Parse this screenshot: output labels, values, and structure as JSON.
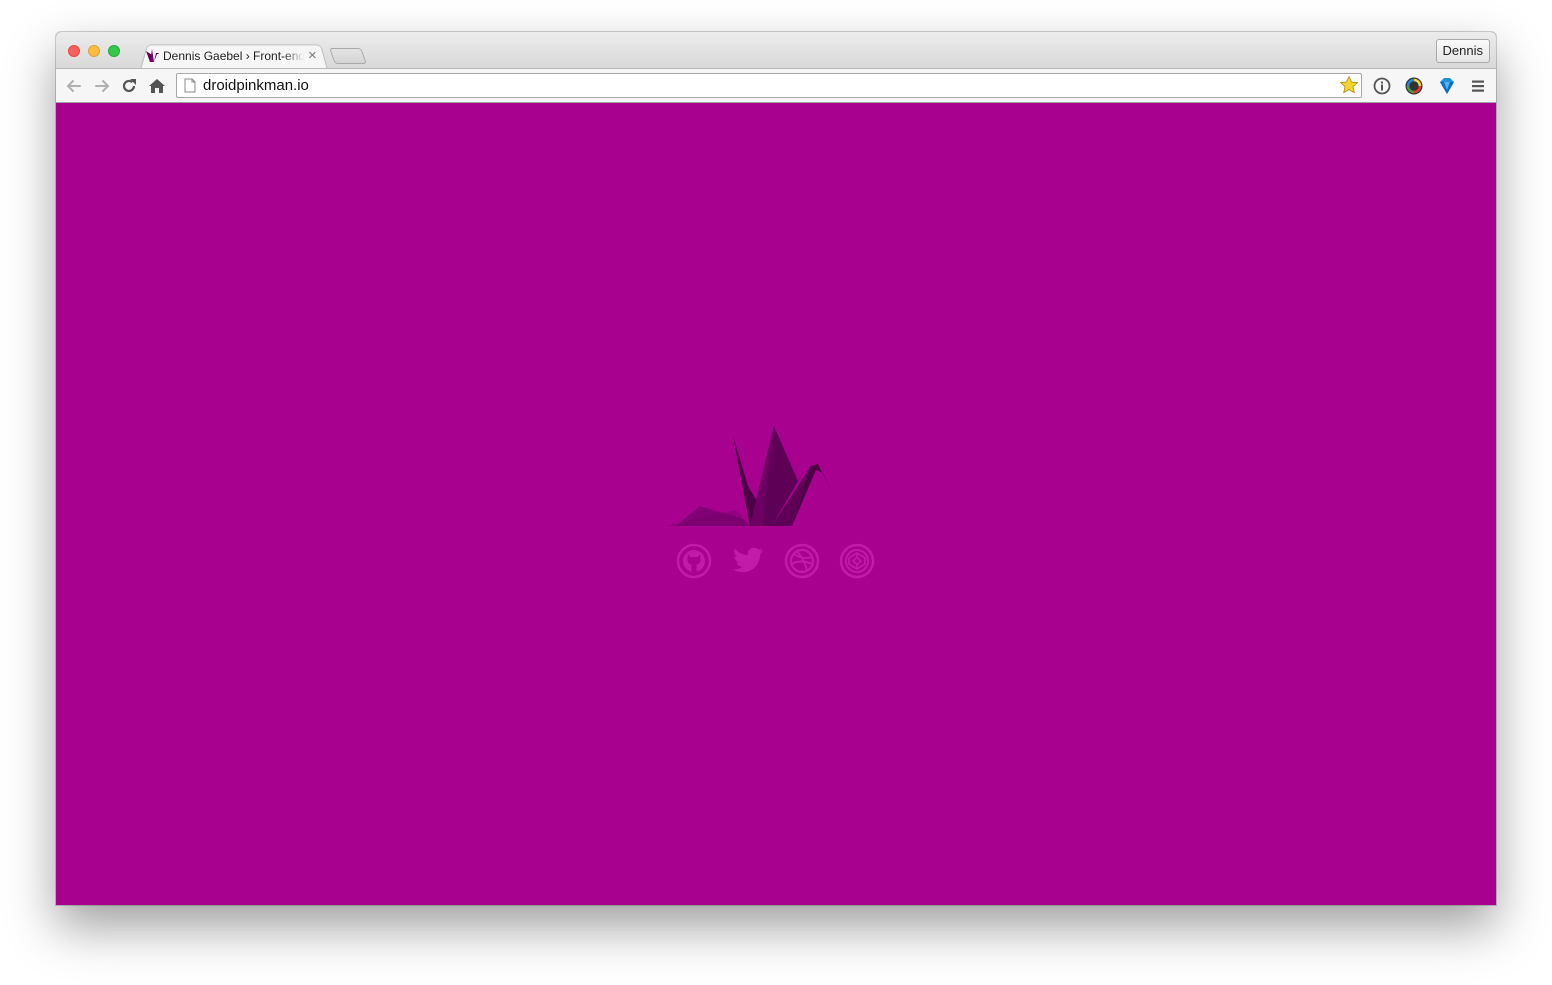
{
  "browser": {
    "tab": {
      "title": "Dennis Gaebel › Front-end",
      "close_glyph": "×",
      "favicon": "crane-icon"
    },
    "profile_name": "Dennis",
    "address_bar": {
      "url": "droidpinkman.io"
    },
    "toolbar_icons": [
      "back-arrow-icon",
      "forward-arrow-icon",
      "reload-icon",
      "home-icon",
      "bookmark-star-icon",
      "info-extension-icon",
      "color-wheel-extension-icon",
      "diamond-extension-icon",
      "menu-icon"
    ]
  },
  "page": {
    "background_color": "#a8008f",
    "logo": "origami-crane-icon",
    "social_links": [
      "github-icon",
      "twitter-icon",
      "dribbble-icon",
      "codepen-icon"
    ]
  },
  "colors": {
    "brand_magenta": "#a8008f",
    "crane_dark": "#5e0055",
    "social_icon": "#c21aa9"
  }
}
